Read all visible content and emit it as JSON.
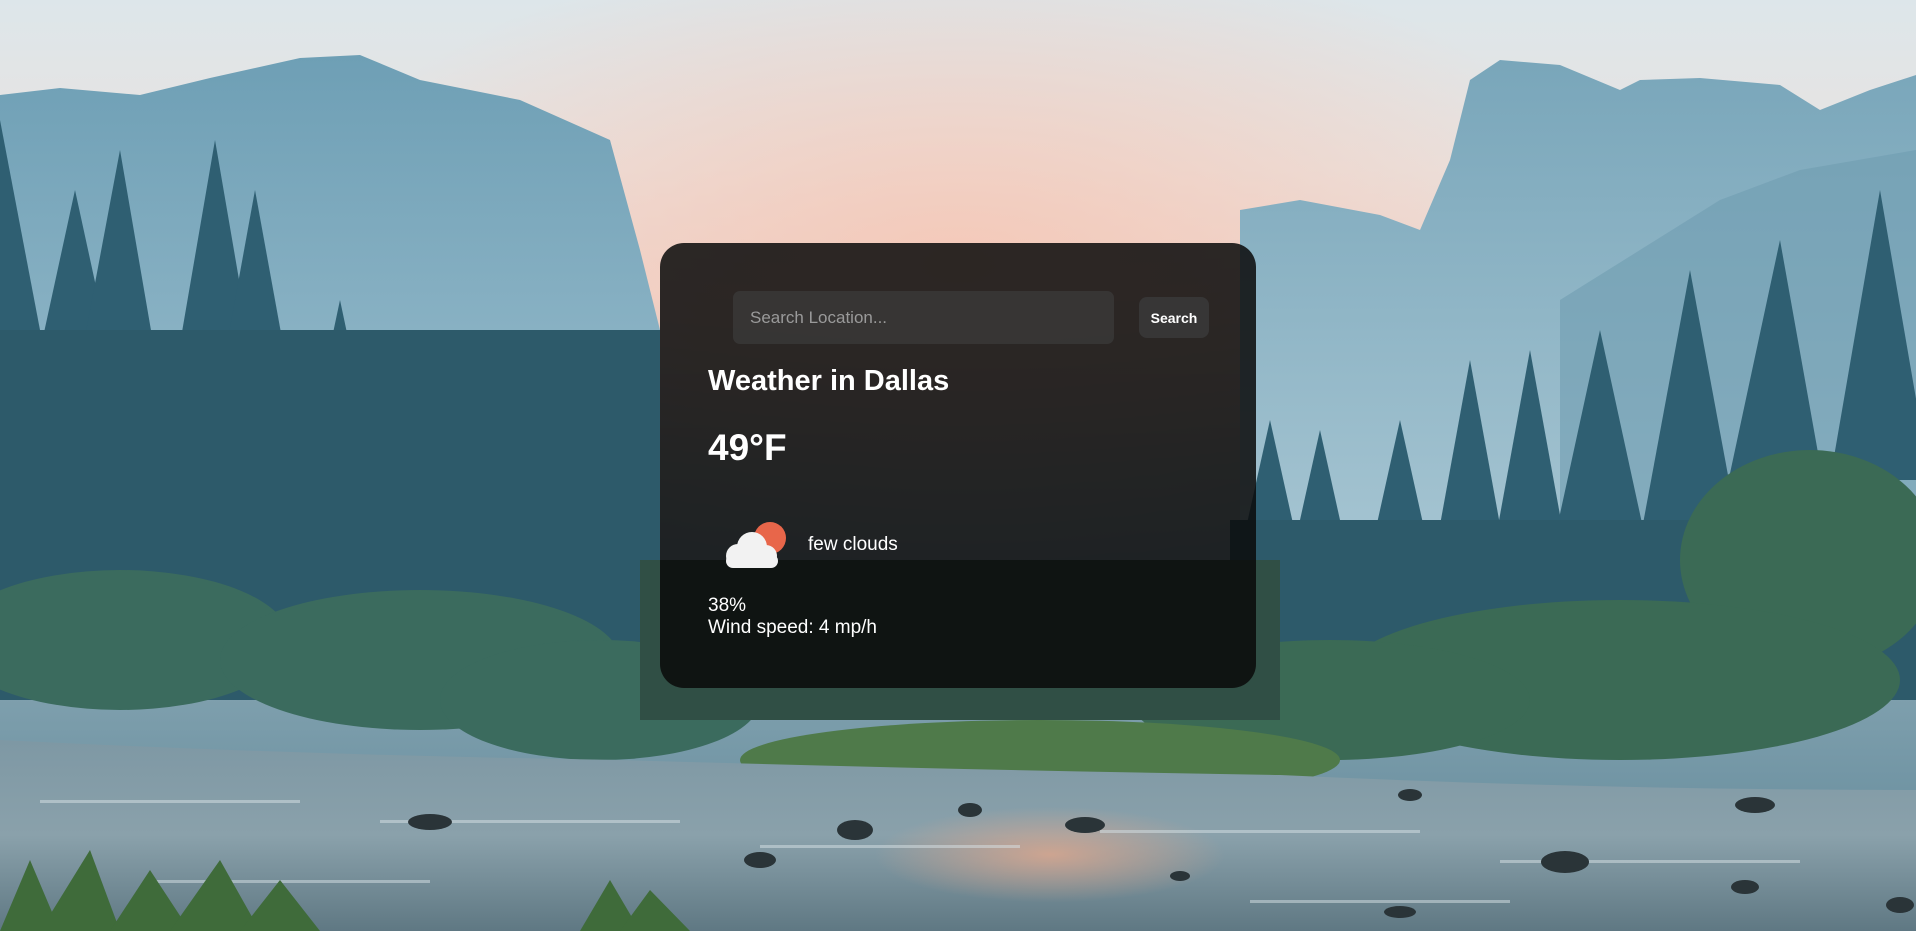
{
  "search": {
    "placeholder": "Search Location...",
    "value": "",
    "button_label": "Search"
  },
  "weather": {
    "city_title": "Weather in Dallas",
    "temperature": "49°F",
    "icon": "few-clouds-icon",
    "description": "few clouds",
    "humidity": "38%",
    "wind": "Wind speed: 4 mp/h"
  },
  "colors": {
    "card_background": "#0a0a0a",
    "text": "#ffffff",
    "sun": "#e8664a",
    "cloud": "#f2f2f2"
  }
}
